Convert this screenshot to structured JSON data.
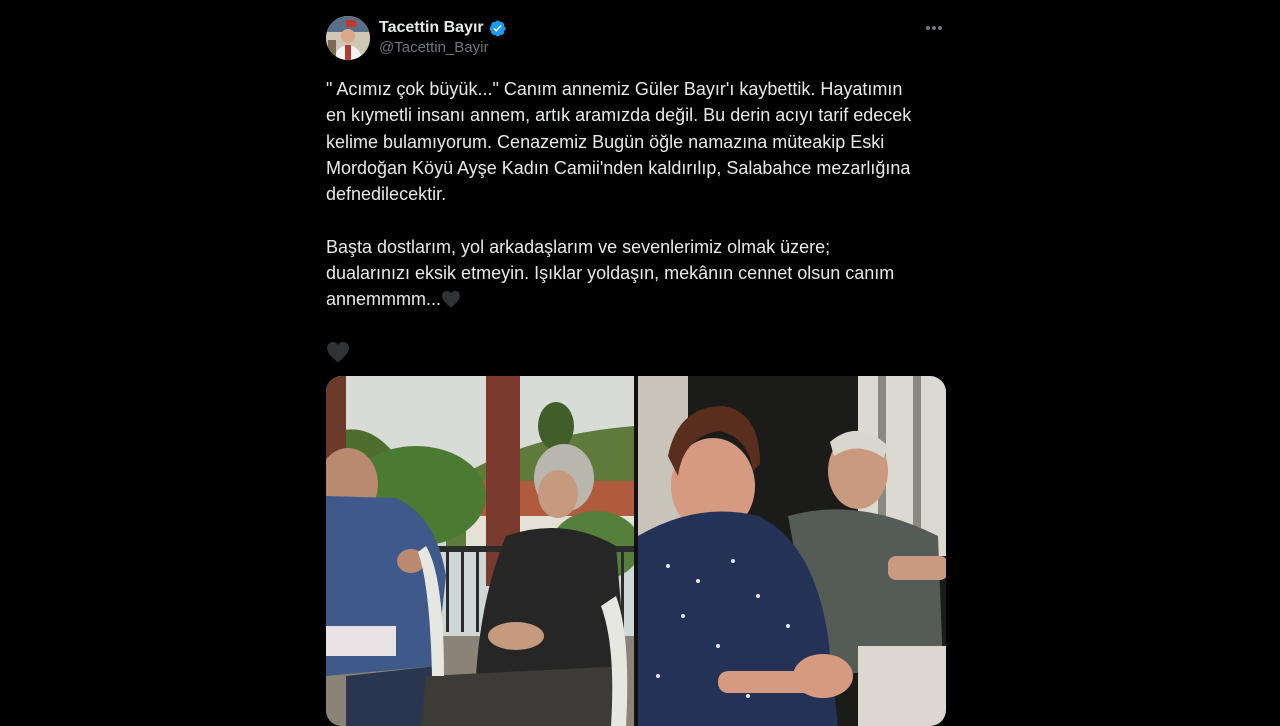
{
  "author": {
    "display_name": "Tacettin Bayır",
    "handle": "@Tacettin_Bayir",
    "verified": true,
    "avatar_icon": "user-avatar"
  },
  "menu_icon": "more-options-icon",
  "tweet": {
    "paragraph1_lines": [
      "\" Acımız çok büyük...\" Canım annemiz Güler Bayır'ı kaybettik. Hayatımın",
      "en kıymetli insanı annem, artık aramızda değil. Bu derin acıyı tarif edecek",
      "kelime bulamıyorum. Cenazemiz Bugün öğle namazına müteakip Eski",
      "Mordoğan Köyü Ayşe Kadın Camii'nden kaldırılıp, Salabahce mezarlığına",
      "defnedilecektir."
    ],
    "paragraph2_lines": [
      "Başta dostlarım, yol arkadaşlarım ve sevenlerimiz olmak üzere;",
      "dualarınızı eksik etmeyin.  Işıklar yoldaşın, mekânın cennet olsun canım",
      "annemmmm..."
    ],
    "emoji": "black-heart-icon"
  },
  "media": {
    "photo_count": 2,
    "photo1": "outdoor-porch-photo",
    "photo2": "elderly-couple-photo"
  },
  "colors": {
    "background": "#000000",
    "text": "#e7e9ea",
    "secondary": "#71767b",
    "verified_blue": "#1d9bf0",
    "heart": "#2f3336"
  }
}
